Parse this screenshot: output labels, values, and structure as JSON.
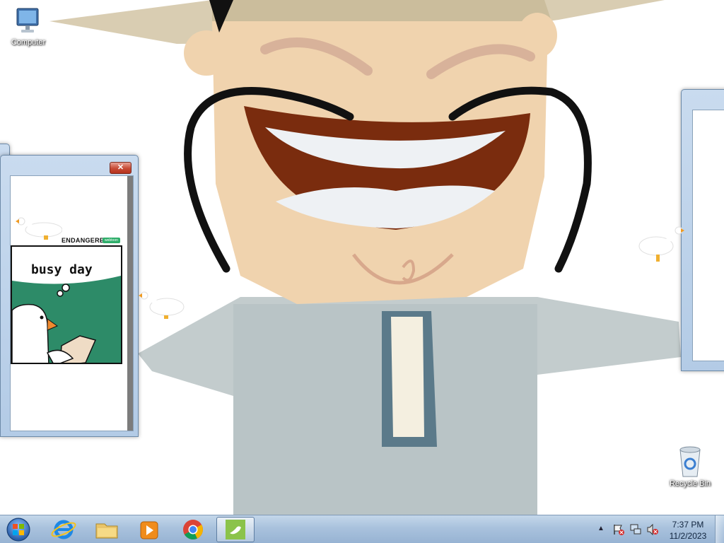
{
  "desktop": {
    "icons": [
      {
        "label": "Computer",
        "icon": "computer-icon"
      },
      {
        "label": "Recycle Bin",
        "icon": "recycle-bin-icon"
      }
    ]
  },
  "comic_window": {
    "comic_title": "ENDANGERED",
    "badge": "webtoon",
    "speech": "busy day",
    "close_label": "✕"
  },
  "taskbar": {
    "start": "start-orb-icon",
    "pinned": [
      {
        "name": "internet-explorer-icon"
      },
      {
        "name": "file-explorer-icon"
      },
      {
        "name": "media-player-icon"
      },
      {
        "name": "chrome-icon"
      },
      {
        "name": "desktop-goose-icon",
        "active": true
      }
    ],
    "tray": {
      "show_hidden": "▲",
      "icons": [
        "action-center-icon",
        "network-icon",
        "volume-muted-icon"
      ]
    },
    "clock": {
      "time": "7:37 PM",
      "date": "11/2/2023"
    }
  },
  "colors": {
    "taskbar": "#a9c2dd",
    "comic_green": "#2d8b68",
    "close_red": "#c74a35"
  }
}
